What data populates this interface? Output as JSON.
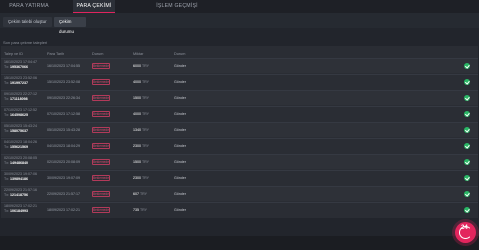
{
  "tabs": [
    "PARA YATIRMA",
    "PARA ÇEKİMİ",
    "İŞLEM GEÇMİŞİ"
  ],
  "subtabs": [
    "Çekim talebi oluştur",
    "Çekim durumu"
  ],
  "section_label": "Son para çekme talepleri",
  "table": {
    "headers": [
      "Talep ve ID",
      "Para Tarih",
      "Durum",
      "Miktar",
      "Durum"
    ],
    "rows": [
      {
        "d1": "16/10/2023 17:04:47",
        "d2": "Tx:",
        "id": "195367066",
        "date": "16/10/2023 17:04:55",
        "status": "Beklemede",
        "amount": "6000",
        "cur": "TRY",
        "method": "Gönder"
      },
      {
        "d1": "15/10/2023 23:52:06",
        "d2": "Tx:",
        "id": "191997237",
        "date": "15/10/2023 23:52:08",
        "status": "Beklemede",
        "amount": "4000",
        "cur": "TRY",
        "method": "Gönder"
      },
      {
        "d1": "09/10/2023 22:27:12",
        "d2": "Tx:",
        "id": "171118098",
        "date": "09/10/2023 22:26:34",
        "status": "Beklemede",
        "amount": "1500",
        "cur": "TRY",
        "method": "Gönder"
      },
      {
        "d1": "07/10/2023 17:12:52",
        "d2": "Tx:",
        "id": "164598625",
        "date": "07/10/2023 17:12:58",
        "status": "Beklemede",
        "amount": "4000",
        "cur": "TRY",
        "method": "Gönder"
      },
      {
        "d1": "05/10/2023 15:43:24",
        "d2": "Tx:",
        "id": "158075637",
        "date": "05/10/2023 15:43:28",
        "status": "Beklemede",
        "amount": "1340",
        "cur": "TRY",
        "method": "Gönder"
      },
      {
        "d1": "04/10/2023 18:04:26",
        "d2": "Tx:",
        "id": "155621569",
        "date": "04/10/2023 18:04:29",
        "status": "Beklemede",
        "amount": "2300",
        "cur": "TRY",
        "method": "Gönder"
      },
      {
        "d1": "02/10/2023 20:08:05",
        "d2": "Tx:",
        "id": "149486840",
        "date": "02/10/2023 20:08:09",
        "status": "Beklemede",
        "amount": "1500",
        "cur": "TRY",
        "method": "Gönder"
      },
      {
        "d1": "30/09/2023 19:07:06",
        "d2": "Tx:",
        "id": "139894186",
        "date": "30/09/2023 19:07:09",
        "status": "Beklemede",
        "amount": "2300",
        "cur": "TRY",
        "method": "Gönder"
      },
      {
        "d1": "22/09/2023 21:57:16",
        "d2": "Tx:",
        "id": "121418756",
        "date": "22/09/2023 21:57:17",
        "status": "Beklemede",
        "amount": "607",
        "cur": "TRY",
        "method": "Gönder"
      },
      {
        "d1": "18/09/2023 17:02:21",
        "d2": "Tx:",
        "id": "106184993",
        "date": "18/09/2023 17:02:21",
        "status": "Beklemede",
        "amount": "735",
        "cur": "TRY",
        "method": "Gönder"
      }
    ]
  },
  "chat_button": {
    "label": "24",
    "icon": "support-24-icon"
  },
  "colors": {
    "accent": "#e0245e",
    "success": "#29b765",
    "status": "#d04a6c"
  }
}
